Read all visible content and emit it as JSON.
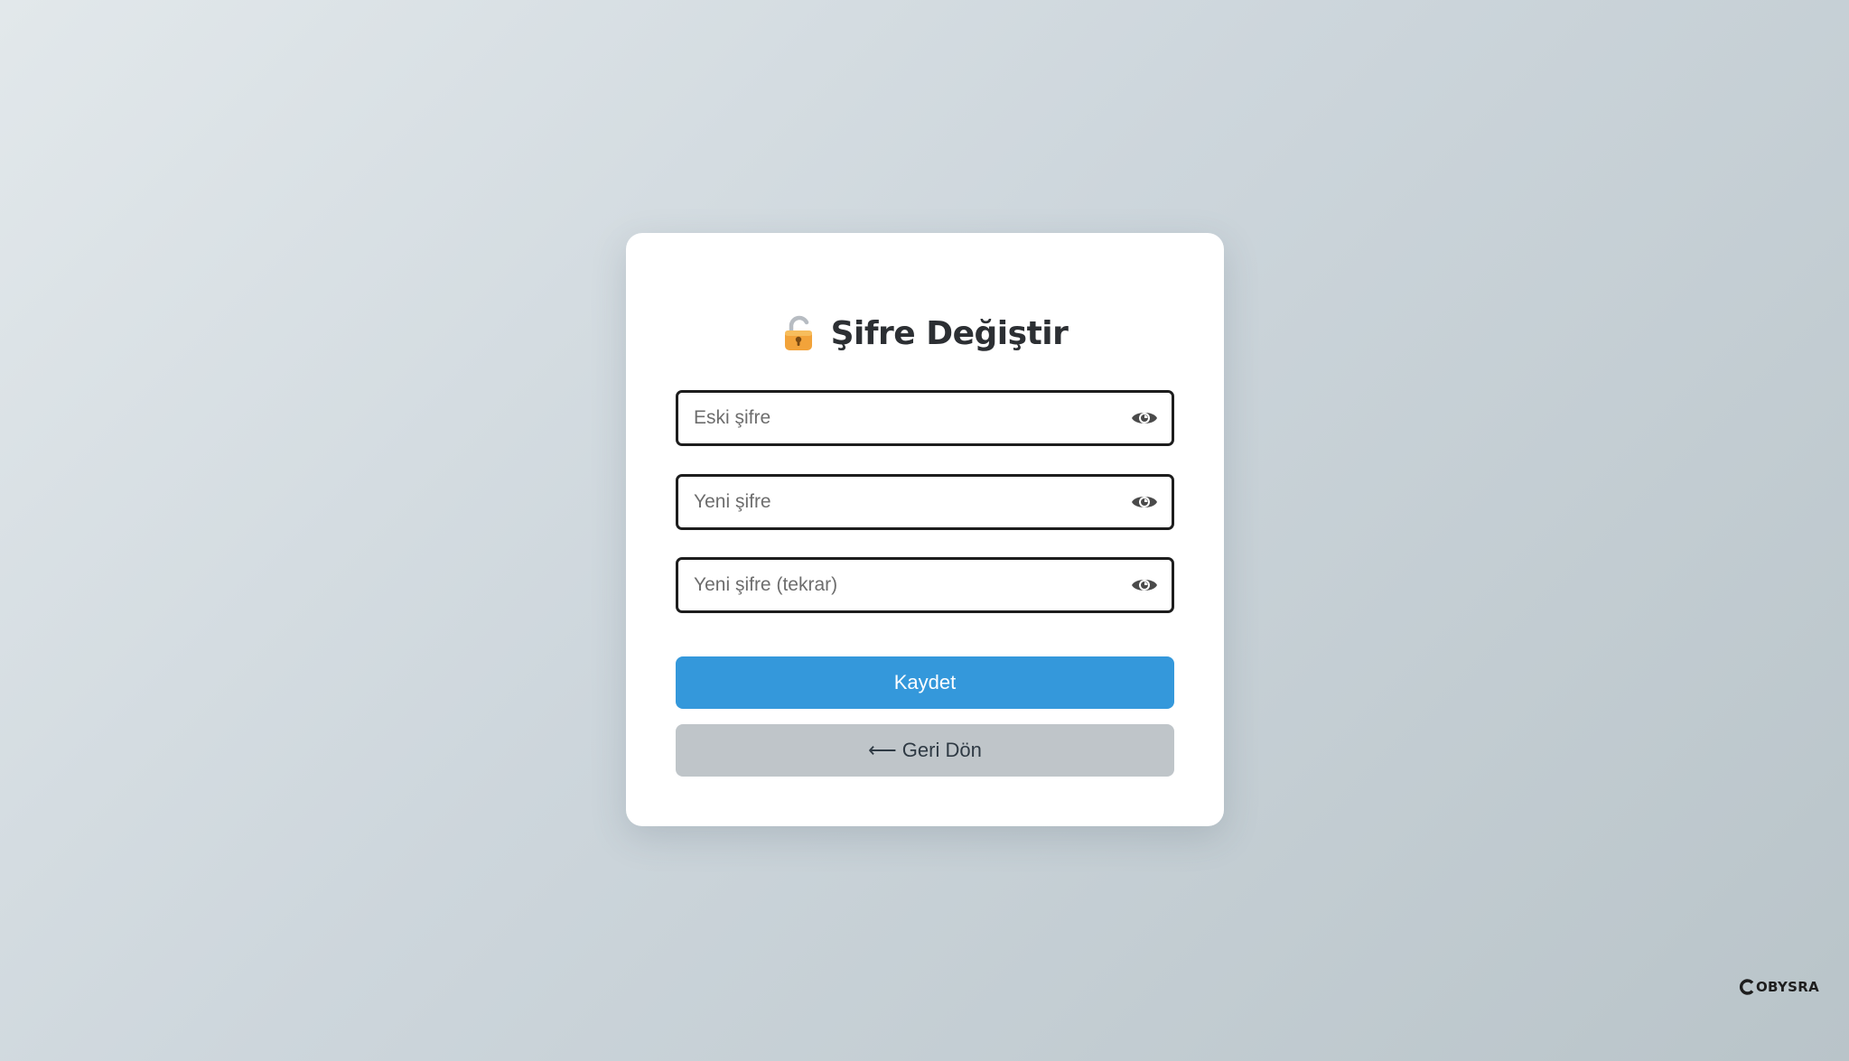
{
  "form": {
    "title": "Şifre Değiştir",
    "title_icon": "lock-icon",
    "fields": [
      {
        "placeholder": "Eski şifre",
        "value": "",
        "toggle_icon": "eye-icon"
      },
      {
        "placeholder": "Yeni şifre",
        "value": "",
        "toggle_icon": "eye-icon"
      },
      {
        "placeholder": "Yeni şifre (tekrar)",
        "value": "",
        "toggle_icon": "eye-icon"
      }
    ],
    "save_label": "Kaydet",
    "back_label": "⟵ Geri Dön"
  },
  "brand": {
    "name": "OBYSRA",
    "mark_icon": "brand-c-icon"
  },
  "colors": {
    "primary": "#3498db",
    "secondary": "#bfc5c9",
    "text_dark": "#2c2f33"
  }
}
